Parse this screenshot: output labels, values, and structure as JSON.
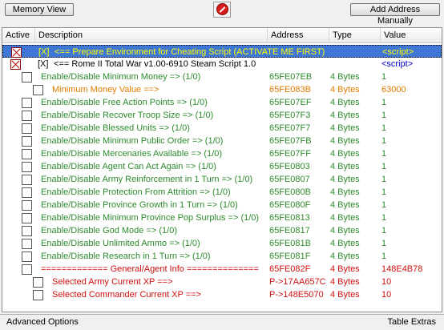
{
  "toolbar": {
    "memory_view": "Memory View",
    "add_address": "Add Address Manually"
  },
  "columns": {
    "active": "Active",
    "description": "Description",
    "address": "Address",
    "type": "Type",
    "value": "Value"
  },
  "rows": [
    {
      "check": "[X]",
      "desc": "<== Prepare Environment for Cheating Script (ACTIVATE ME FIRST)",
      "address": "",
      "type": "",
      "value": "<script>"
    },
    {
      "check": "[X]",
      "desc": "<== Rome II Total War v1.00-6910 Steam Script 1.0",
      "address": "",
      "type": "",
      "value": "<script>"
    },
    {
      "desc": "Enable/Disable Minimum Money => (1/0)",
      "address": "65FE07EB",
      "type": "4 Bytes",
      "value": "1"
    },
    {
      "desc": "Minimum Money Value ==>",
      "address": "65FE083B",
      "type": "4 Bytes",
      "value": "63000"
    },
    {
      "desc": "Enable/Disable Free Action Points => (1/0)",
      "address": "65FE07EF",
      "type": "4 Bytes",
      "value": "1"
    },
    {
      "desc": "Enable/Disable Recover Troop Size => (1/0)",
      "address": "65FE07F3",
      "type": "4 Bytes",
      "value": "1"
    },
    {
      "desc": "Enable/Disable Blessed Units => (1/0)",
      "address": "65FE07F7",
      "type": "4 Bytes",
      "value": "1"
    },
    {
      "desc": "Enable/Disable Minimum Public Order => (1/0)",
      "address": "65FE07FB",
      "type": "4 Bytes",
      "value": "1"
    },
    {
      "desc": "Enable/Disable Mercenaries Available => (1/0)",
      "address": "65FE07FF",
      "type": "4 Bytes",
      "value": "1"
    },
    {
      "desc": "Enable/Disable Agent Can Act Again => (1/0)",
      "address": "65FE0803",
      "type": "4 Bytes",
      "value": "1"
    },
    {
      "desc": "Enable/Disable Army Reinforcement in 1 Turn => (1/0)",
      "address": "65FE0807",
      "type": "4 Bytes",
      "value": "1"
    },
    {
      "desc": "Enable/Disable Protection From Attrition => (1/0)",
      "address": "65FE080B",
      "type": "4 Bytes",
      "value": "1"
    },
    {
      "desc": "Enable/Disable Province Growth in 1 Turn => (1/0)",
      "address": "65FE080F",
      "type": "4 Bytes",
      "value": "1"
    },
    {
      "desc": "Enable/Disable Minimum Province Pop Surplus => (1/0)",
      "address": "65FE0813",
      "type": "4 Bytes",
      "value": "1"
    },
    {
      "desc": "Enable/Disable God Mode => (1/0)",
      "address": "65FE0817",
      "type": "4 Bytes",
      "value": "1"
    },
    {
      "desc": "Enable/Disable Unlimited Ammo => (1/0)",
      "address": "65FE081B",
      "type": "4 Bytes",
      "value": "1"
    },
    {
      "desc": "Enable/Disable Research in 1 Turn => (1/0)",
      "address": "65FE081F",
      "type": "4 Bytes",
      "value": "1"
    },
    {
      "desc": "============= General/Agent Info ==============",
      "address": "65FE082F",
      "type": "4 Bytes",
      "value": "148E4B78"
    },
    {
      "desc": "Selected Army Current XP ==>",
      "address": "P->17AA657C",
      "type": "4 Bytes",
      "value": "10"
    },
    {
      "desc": "Selected Commander Current XP ==>",
      "address": "P->148E5070",
      "type": "4 Bytes",
      "value": "10"
    }
  ],
  "status": {
    "advanced": "Advanced Options",
    "table_extras": "Table Extras"
  },
  "colors": {
    "selection": "#3f77d6",
    "green": "#2e8b2e",
    "orange": "#e07b00",
    "red": "#d01010"
  },
  "icons": {
    "stop": "stop-icon"
  }
}
